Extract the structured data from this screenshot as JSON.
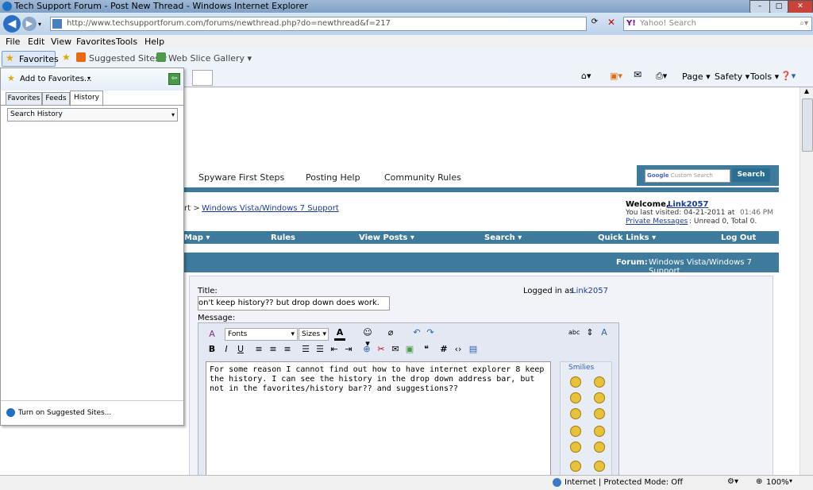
{
  "window": {
    "title": "Tech Support Forum - Post New Thread - Windows Internet Explorer",
    "minimize": "–",
    "maximize": "□",
    "close": "✕"
  },
  "address": {
    "url": "http://www.techsupportforum.com/forums/newthread.php?do=newthread&f=217",
    "search_placeholder": "Yahoo! Search"
  },
  "menu": [
    "File",
    "Edit",
    "View",
    "Favorites",
    "Tools",
    "Help"
  ],
  "favorites_bar": {
    "favorites_button": "Favorites",
    "suggested_sites": "Suggested Sites ▾",
    "web_slice_gallery": "Web Slice Gallery ▾"
  },
  "command_bar": [
    "Page ▾",
    "Safety ▾",
    "Tools ▾",
    "❓▾"
  ],
  "favorites_panel": {
    "add_to_favorites": "Add to Favorites...",
    "tabs": [
      "Favorites",
      "Feeds",
      "History"
    ],
    "active_tab": "History",
    "history_dropdown": "Search History",
    "turn_on_suggested": "Turn on Suggested Sites..."
  },
  "site": {
    "top_links": [
      "Spyware First Steps",
      "Posting Help",
      "Community Rules"
    ],
    "google_placeholder": "Custom Search",
    "search_button": "Search",
    "breadcrumb_prefix": "rt >",
    "breadcrumb_link": "Windows Vista/Windows 7 Support",
    "welcome_label": "Welcome,",
    "welcome_user": "Link2057",
    "last_visited_label": "You last visited: 04-21-2011 at",
    "last_visited_time": "01:46 PM",
    "private_messages": "Private Messages",
    "pm_status": ": Unread 0, Total 0.",
    "nav_items": [
      "Map ▾",
      "Rules",
      "View Posts ▾",
      "Search ▾",
      "Quick Links ▾",
      "Log Out"
    ],
    "forum_label": "Forum:",
    "forum_name": "Windows Vista/Windows 7 Support",
    "title_label": "Title:",
    "title_value": "on't keep history?? but drop down does work.",
    "logged_in_label": "Logged in as",
    "logged_in_user": "Link2057",
    "message_label": "Message:",
    "font_select": "Fonts",
    "size_select": "Sizes",
    "message_text": "For some reason I cannot find out how to have internet explorer 8 keep the history. I can see the history in the drop down address bar, but not in the favorites/history bar?? and suggestions??",
    "smilies_label": "Smilies"
  },
  "status": {
    "zone": "Internet | Protected Mode: Off",
    "zoom": "100%"
  }
}
